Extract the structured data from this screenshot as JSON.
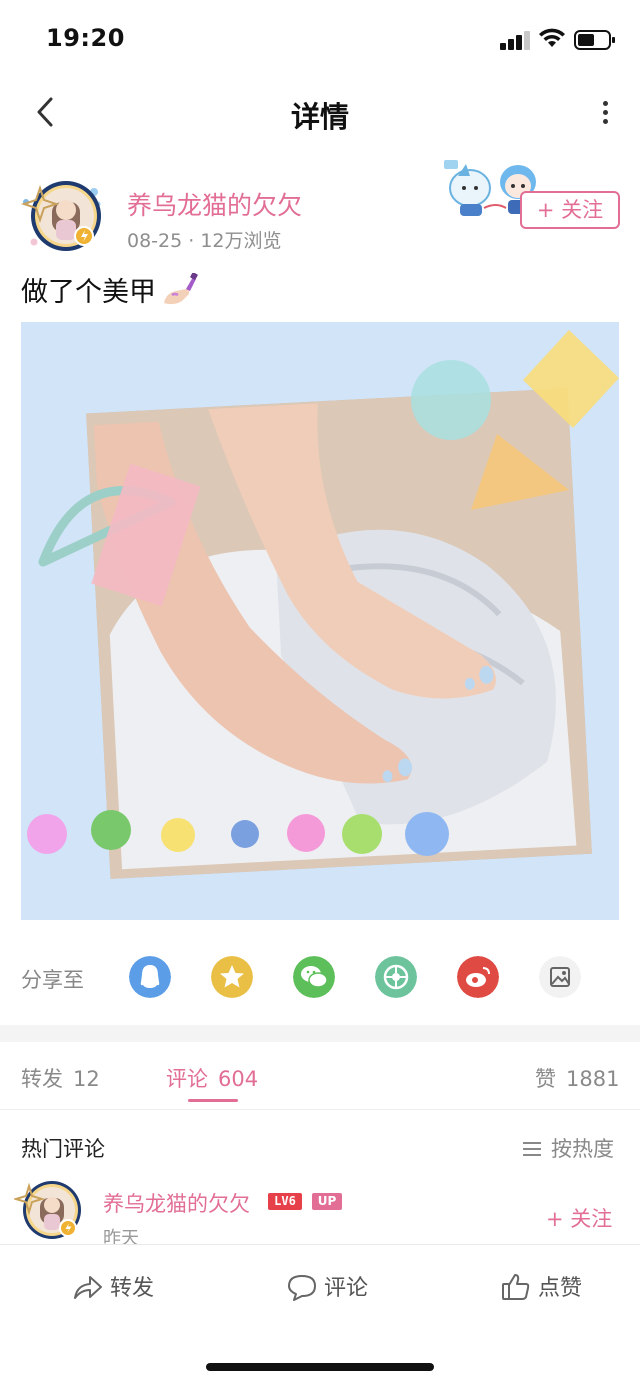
{
  "status_bar": {
    "time": "19:20"
  },
  "nav": {
    "title": "详情"
  },
  "post": {
    "author_name": "养乌龙猫的欠欠",
    "meta": "08-25 · 12万浏览",
    "follow_label": "+ 关注",
    "text": "做了个美甲"
  },
  "share": {
    "label": "分享至",
    "targets": [
      {
        "icon": "qq-icon",
        "color": "#5b9de6"
      },
      {
        "icon": "qzone-icon",
        "color": "#eabf45"
      },
      {
        "icon": "wechat-icon",
        "color": "#5dbf5a"
      },
      {
        "icon": "moments-icon",
        "color": "#6cc39c"
      },
      {
        "icon": "weibo-icon",
        "color": "#df4b43"
      },
      {
        "icon": "save-image-icon",
        "color": "#f2f2f2"
      }
    ]
  },
  "tabs": {
    "repost": {
      "label": "转发",
      "count": "12"
    },
    "comments": {
      "label": "评论",
      "count": "604"
    },
    "likes": {
      "label": "赞",
      "count": "1881"
    }
  },
  "comments_section": {
    "title": "热门评论",
    "sort_label": "按热度",
    "items": [
      {
        "name": "养乌龙猫的欠欠",
        "level": "LV6",
        "badge": "UP",
        "time": "昨天",
        "follow_label": "+ 关注"
      }
    ]
  },
  "bottom_bar": {
    "repost": "转发",
    "comment": "评论",
    "like": "点赞"
  },
  "colors": {
    "accent": "#e26e96",
    "image_bg": "#d1e4f8"
  }
}
